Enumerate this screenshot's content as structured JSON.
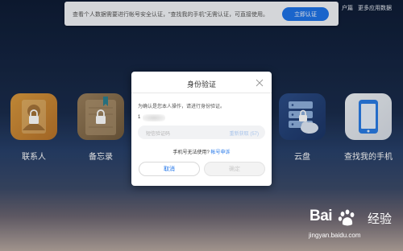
{
  "notice": {
    "text": "查看个人数据需要进行帐号安全认证，\"查找我的手机\"无需认证，可直接使用。",
    "button": "立即认证"
  },
  "top_links": [
    "户篇",
    "更多应用数据"
  ],
  "apps": [
    {
      "label": "联系人",
      "icon": "contacts-icon",
      "color": "#c98832"
    },
    {
      "label": "备忘录",
      "icon": "notes-icon",
      "color": "#8a7150"
    },
    {
      "label": "云盘",
      "icon": "cloud-drive-icon",
      "color": "#2f4f86"
    },
    {
      "label": "查找我的手机",
      "icon": "find-phone-icon",
      "color": "#e6eaef"
    }
  ],
  "dialog": {
    "title": "身份验证",
    "description": "为确认是您本人操作，请进行身份验证。",
    "phone_prefix": "1",
    "code_placeholder": "短信验证码",
    "resend": "重新获取 (57)",
    "help_text": "手机号无法使用?",
    "help_link": "帐号申诉",
    "cancel": "取消",
    "confirm": "确定"
  },
  "watermark": {
    "brand": "Bai",
    "jingyan": "经验",
    "url": "jingyan.baidu.com"
  },
  "colors": {
    "accent": "#1e73e8",
    "background_top": "#0e1c35",
    "background_bottom": "#b7a8a0"
  }
}
